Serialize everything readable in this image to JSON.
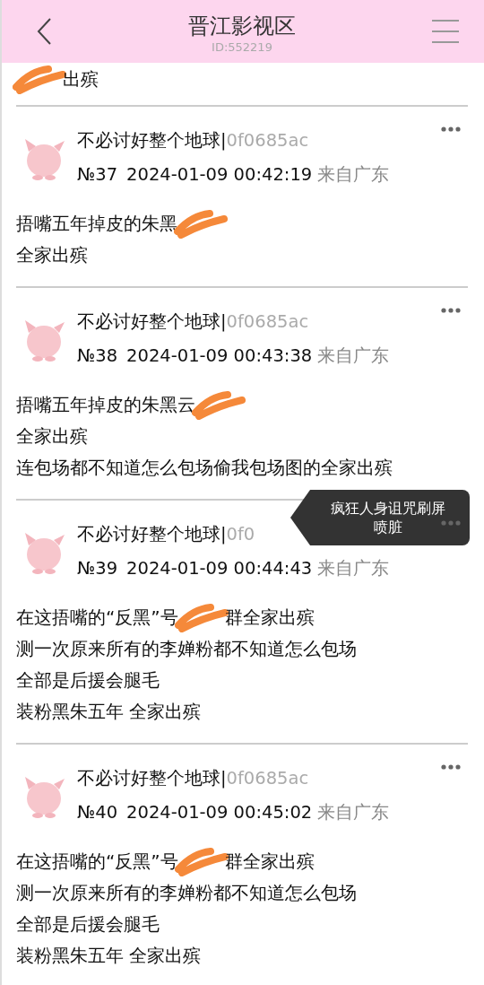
{
  "header": {
    "title": "晋江影视区",
    "subtitle": "ID:552219"
  },
  "top_fragment": [
    {
      "kind": "scribble"
    },
    {
      "kind": "text",
      "text": "出殡"
    }
  ],
  "posts": [
    {
      "name": "不必讨好整个地球|",
      "user_id": "0f0685ac",
      "number": "№37",
      "time": "2024-01-09 00:42:19",
      "location": "来自广东",
      "lines": [
        [
          {
            "kind": "text",
            "text": "捂嘴五年掉皮的朱黑"
          },
          {
            "kind": "scribble"
          }
        ],
        [
          {
            "kind": "text",
            "text": "全家出殡"
          }
        ]
      ]
    },
    {
      "name": "不必讨好整个地球|",
      "user_id": "0f0685ac",
      "number": "№38",
      "time": "2024-01-09 00:43:38",
      "location": "来自广东",
      "lines": [
        [
          {
            "kind": "text",
            "text": "捂嘴五年掉皮的朱黑云"
          },
          {
            "kind": "scribble"
          }
        ],
        [
          {
            "kind": "text",
            "text": "全家出殡"
          }
        ],
        [
          {
            "kind": "text",
            "text": "连包场都不知道怎么包场偷我包场图的全家出殡"
          }
        ]
      ]
    },
    {
      "name": "不必讨好整个地球|",
      "user_id": "0f0",
      "number": "№39",
      "time": "2024-01-09 00:44:43",
      "location": "来自广东",
      "tooltip": [
        "疯狂人身诅咒刷屏",
        "喷脏"
      ],
      "lines": [
        [
          {
            "kind": "text",
            "text": "在这捂嘴的“反黑”号"
          },
          {
            "kind": "scribble"
          },
          {
            "kind": "text",
            "text": "群全家出殡"
          }
        ],
        [
          {
            "kind": "text",
            "text": "测一次原来所有的李婵粉都不知道怎么包场"
          }
        ],
        [
          {
            "kind": "text",
            "text": "全部是后援会腿毛"
          }
        ],
        [
          {
            "kind": "text",
            "text": "装粉黑朱五年 全家出殡"
          }
        ]
      ]
    },
    {
      "name": "不必讨好整个地球|",
      "user_id": "0f0685ac",
      "number": "№40",
      "time": "2024-01-09 00:45:02",
      "location": "来自广东",
      "lines": [
        [
          {
            "kind": "text",
            "text": "在这捂嘴的“反黑”号"
          },
          {
            "kind": "scribble"
          },
          {
            "kind": "text",
            "text": "群全家出殡"
          }
        ],
        [
          {
            "kind": "text",
            "text": "测一次原来所有的李婵粉都不知道怎么包场"
          }
        ],
        [
          {
            "kind": "text",
            "text": "全部是后援会腿毛"
          }
        ],
        [
          {
            "kind": "text",
            "text": "装粉黑朱五年 全家出殡"
          }
        ]
      ]
    }
  ]
}
